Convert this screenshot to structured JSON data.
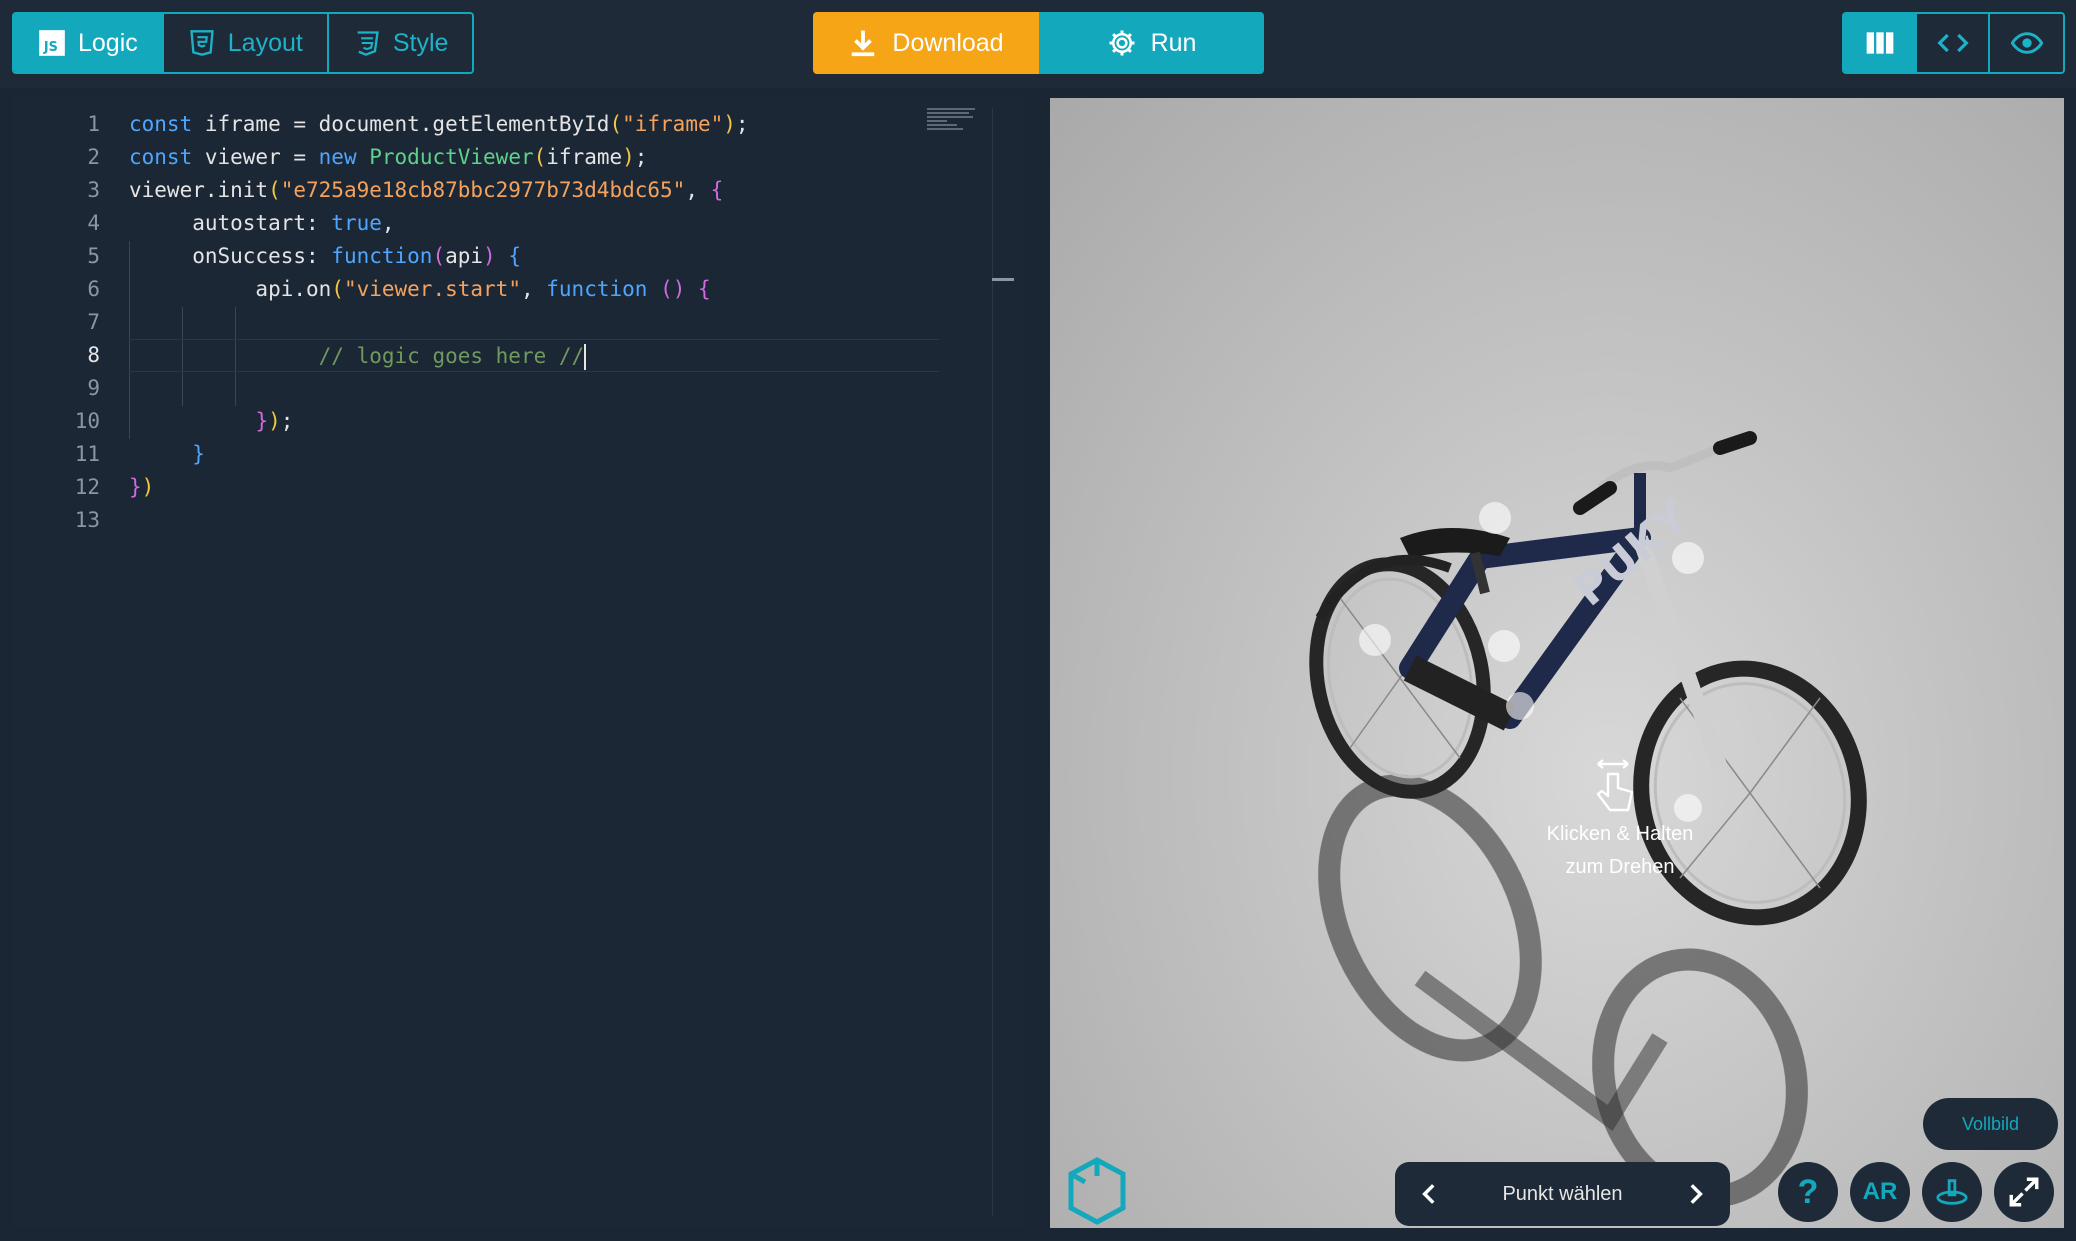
{
  "tabs": [
    {
      "label": "Logic",
      "icon": "js-icon",
      "active": true
    },
    {
      "label": "Layout",
      "icon": "html5-icon",
      "active": false
    },
    {
      "label": "Style",
      "icon": "css3-icon",
      "active": false
    }
  ],
  "actions": {
    "download_label": "Download",
    "run_label": "Run"
  },
  "view_modes": [
    {
      "name": "split-view",
      "icon": "columns-icon",
      "active": true
    },
    {
      "name": "code-view",
      "icon": "code-icon",
      "active": false
    },
    {
      "name": "preview-view",
      "icon": "eye-icon",
      "active": false
    }
  ],
  "editor": {
    "current_line": 8,
    "line_numbers": [
      "1",
      "2",
      "3",
      "4",
      "5",
      "6",
      "7",
      "8",
      "9",
      "10",
      "11",
      "12",
      "13"
    ]
  },
  "viewer": {
    "hint_line1": "Klicken & Halten",
    "hint_line2": "zum Drehen",
    "fullscreen_label": "Vollbild",
    "point_selector_label": "Punkt wählen",
    "ar_label": "AR",
    "help_label": "?"
  },
  "colors": {
    "accent": "#14a8bd",
    "download": "#f5a516",
    "background": "#1b2634",
    "panel": "#1e2a38"
  }
}
